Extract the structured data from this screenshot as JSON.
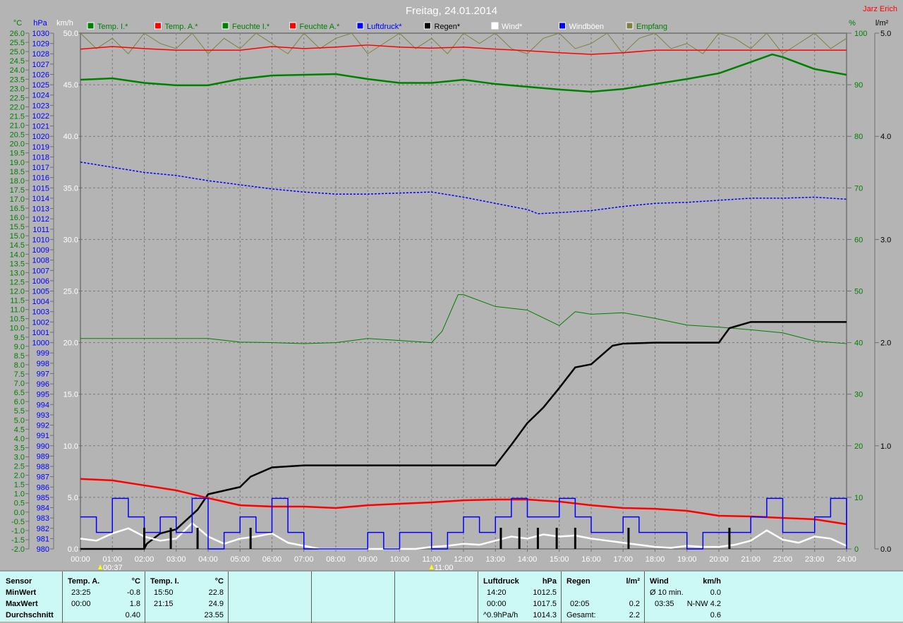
{
  "title": "Freitag, 24.01.2014",
  "author": "Jarz Erich",
  "colors": {
    "background": "#b4b4b4",
    "grid": "#808080",
    "temp_in": "#008000",
    "temp_out": "#ff0000",
    "hum_in": "#008000",
    "hum_out": "#ff0000",
    "pressure": "#0000ff",
    "rain": "#000000",
    "wind": "#ffffff",
    "gust": "#0000ff",
    "reception": "#808040",
    "panel": "#ccf8f6"
  },
  "legend": [
    {
      "label": "Temp. I.*",
      "color": "#008000",
      "text_color": "#008000"
    },
    {
      "label": "Temp. A.*",
      "color": "#ff0000",
      "text_color": "#008000"
    },
    {
      "label": "Feuchte I.*",
      "color": "#008000",
      "text_color": "#008000"
    },
    {
      "label": "Feuchte A.*",
      "color": "#ff0000",
      "text_color": "#008000"
    },
    {
      "label": "Luftdruck*",
      "color": "#0000ff",
      "text_color": "#0000ff"
    },
    {
      "label": "Regen*",
      "color": "#000000",
      "text_color": "#000000"
    },
    {
      "label": "Wind*",
      "color": "#ffffff",
      "text_color": "#ffffff"
    },
    {
      "label": "Windböen",
      "color": "#0000ff",
      "text_color": "#ffffff"
    },
    {
      "label": "Empfang",
      "color": "#808040",
      "text_color": "#008000"
    }
  ],
  "chart_data": {
    "type": "line",
    "title": "Freitag, 24.01.2014",
    "x_unit": "hours",
    "xlim": [
      0,
      24
    ],
    "x_ticks": [
      "00:00",
      "01:00",
      "02:00",
      "03:00",
      "04:00",
      "05:00",
      "06:00",
      "07:00",
      "08:00",
      "09:00",
      "10:00",
      "11:00",
      "12:00",
      "13:00",
      "14:00",
      "15:00",
      "16:00",
      "17:00",
      "18:00",
      "19:00",
      "20:00",
      "21:00",
      "22:00",
      "23:00",
      "24:00"
    ],
    "axes": {
      "temp": {
        "unit": "°C",
        "min": -2.0,
        "max": 26.0,
        "step": 0.5,
        "decimals": 1,
        "color": "#008000"
      },
      "pressure": {
        "unit": "hPa",
        "min": 980,
        "max": 1030,
        "step": 1,
        "decimals": 0,
        "color": "#0000ff"
      },
      "wind": {
        "unit": "km/h",
        "min": 0,
        "max": 50,
        "step": 5,
        "decimals": 1,
        "color": "#ffffff"
      },
      "humidity": {
        "unit": "%",
        "min": 0,
        "max": 100,
        "step": 10,
        "decimals": 0,
        "color": "#008000"
      },
      "rain": {
        "unit": "l/m²",
        "min": 0,
        "max": 5,
        "step": 1,
        "decimals": 1,
        "color": "#000000"
      }
    },
    "grid": true,
    "legend_position": "top",
    "series": [
      {
        "name": "Temp. I.*",
        "axis": "temp",
        "color": "#008000",
        "width": 2.5,
        "x": [
          0,
          1,
          2,
          3,
          4,
          5,
          6,
          7,
          8,
          9,
          10,
          11,
          12,
          13,
          14,
          15,
          16,
          17,
          18,
          19,
          20,
          21,
          21.67,
          22,
          23,
          24
        ],
        "y": [
          23.47,
          23.55,
          23.3,
          23.17,
          23.17,
          23.51,
          23.7,
          23.74,
          23.78,
          23.51,
          23.3,
          23.3,
          23.47,
          23.24,
          23.09,
          22.94,
          22.82,
          22.97,
          23.24,
          23.51,
          23.82,
          24.43,
          24.85,
          24.7,
          24.05,
          23.74
        ]
      },
      {
        "name": "Temp. A.*",
        "axis": "temp",
        "color": "#ff0000",
        "width": 2.5,
        "x": [
          0,
          1,
          2,
          3,
          4,
          5,
          6,
          7,
          8,
          9,
          10,
          11,
          12,
          13,
          14,
          15,
          16,
          17,
          18,
          19,
          20,
          21,
          22,
          23,
          24
        ],
        "y": [
          1.8,
          1.72,
          1.45,
          1.18,
          0.76,
          0.37,
          0.3,
          0.3,
          0.22,
          0.37,
          0.45,
          0.53,
          0.64,
          0.68,
          0.68,
          0.57,
          0.37,
          0.22,
          0.18,
          0.07,
          -0.2,
          -0.24,
          -0.32,
          -0.39,
          -0.66
        ]
      },
      {
        "name": "Feuchte I.*",
        "axis": "humidity",
        "color": "#008000",
        "width": 1,
        "x": [
          0,
          4,
          5,
          6,
          7,
          8,
          9,
          10,
          11,
          11.33,
          11.83,
          12,
          13,
          14,
          15,
          15.5,
          16,
          17,
          18,
          19,
          20,
          21,
          22,
          23,
          24
        ],
        "y": [
          40.8,
          40.8,
          40.1,
          40.0,
          39.8,
          40.0,
          40.8,
          40.4,
          40.0,
          42.2,
          49.3,
          49.3,
          47.0,
          46.3,
          43.3,
          46.0,
          45.5,
          45.8,
          44.7,
          43.4,
          43.0,
          42.5,
          41.9,
          40.3,
          39.8
        ]
      },
      {
        "name": "Feuchte A.*",
        "axis": "humidity",
        "color": "#ff0000",
        "width": 1.5,
        "x": [
          0,
          1,
          2,
          3,
          4,
          5,
          6,
          7,
          8,
          9,
          10,
          11,
          12,
          13,
          14,
          15,
          16,
          17,
          18,
          19,
          20,
          21,
          22,
          23,
          24
        ],
        "y": [
          96.9,
          97.4,
          97.0,
          96.7,
          96.7,
          96.7,
          97.4,
          97.0,
          97.3,
          97.7,
          97.3,
          97.1,
          97.3,
          96.9,
          96.6,
          96.2,
          95.9,
          96.2,
          96.7,
          96.7,
          96.7,
          96.7,
          96.7,
          96.7,
          96.7
        ]
      },
      {
        "name": "Luftdruck*",
        "axis": "pressure",
        "color": "#0000ff",
        "width": 1.5,
        "dashed": true,
        "x": [
          0,
          1,
          2,
          3,
          4,
          5,
          6,
          7,
          8,
          9,
          10,
          11,
          12,
          13,
          14,
          14.33,
          15,
          16,
          17,
          18,
          19,
          20,
          21,
          22,
          23,
          24
        ],
        "y": [
          1017.5,
          1017.0,
          1016.5,
          1016.2,
          1015.7,
          1015.3,
          1014.9,
          1014.6,
          1014.4,
          1014.4,
          1014.5,
          1014.6,
          1014.1,
          1013.5,
          1012.9,
          1012.5,
          1012.6,
          1012.8,
          1013.2,
          1013.5,
          1013.6,
          1013.8,
          1014.0,
          1014.0,
          1014.1,
          1013.9
        ]
      },
      {
        "name": "Regen*",
        "axis": "rain",
        "color": "#000000",
        "width": 2.5,
        "x": [
          0,
          2.0,
          2.08,
          2.5,
          3.0,
          3.67,
          4.0,
          5.0,
          5.33,
          6.0,
          7.0,
          13.0,
          13.5,
          14.0,
          14.5,
          15.0,
          15.5,
          16.0,
          16.67,
          17.0,
          18.0,
          20.0,
          20.33,
          21.0,
          24.0
        ],
        "y": [
          0,
          0,
          0.05,
          0.15,
          0.19,
          0.38,
          0.53,
          0.6,
          0.7,
          0.79,
          0.81,
          0.81,
          1.01,
          1.22,
          1.37,
          1.56,
          1.76,
          1.79,
          1.97,
          1.99,
          2.0,
          2.0,
          2.14,
          2.2,
          2.2
        ]
      },
      {
        "name": "Wind*",
        "axis": "wind",
        "color": "#ffffff",
        "width": 2.5,
        "x": [
          0,
          0.5,
          1,
          1.5,
          2,
          2.5,
          3,
          3.5,
          4,
          4.5,
          5,
          5.5,
          6,
          6.5,
          7,
          7.5,
          8,
          8.5,
          9,
          9.5,
          10,
          10.5,
          11,
          11.5,
          12,
          12.5,
          13,
          13.5,
          14,
          14.5,
          15,
          15.5,
          16,
          16.5,
          17,
          17.5,
          18,
          18.5,
          19,
          19.5,
          20,
          20.5,
          21,
          21.5,
          22,
          22.5,
          23,
          23.5,
          24
        ],
        "y": [
          1.0,
          0.8,
          1.5,
          2.0,
          1.2,
          0.8,
          1.0,
          2.5,
          1.2,
          0.5,
          1.0,
          1.2,
          1.5,
          0.6,
          0.3,
          0,
          0,
          0,
          0,
          0,
          0,
          0,
          0.2,
          0.3,
          0.5,
          0.4,
          0.8,
          1.2,
          1.0,
          1.4,
          1.2,
          1.3,
          1.0,
          0.8,
          0.6,
          0.4,
          0.2,
          0.1,
          0.3,
          0.2,
          0.2,
          0.4,
          0.8,
          1.8,
          0.9,
          0.6,
          1.2,
          1.0,
          0.3
        ]
      },
      {
        "name": "Windböen",
        "axis": "wind",
        "color": "#0000ff",
        "width": 1.5,
        "step": true,
        "x": [
          0,
          0.5,
          1,
          1.5,
          2,
          2.5,
          3,
          3.5,
          4,
          4.5,
          5,
          5.5,
          6,
          6.5,
          7,
          7.5,
          8,
          8.5,
          9,
          9.5,
          10,
          10.5,
          11,
          11.5,
          12,
          12.5,
          13,
          13.5,
          14,
          14.5,
          15,
          15.5,
          16,
          16.5,
          17,
          17.5,
          18,
          18.5,
          19,
          19.5,
          20,
          20.5,
          21,
          21.5,
          22,
          22.5,
          23,
          23.5,
          24
        ],
        "y": [
          3.1,
          1.6,
          4.9,
          3.1,
          1.6,
          3.1,
          1.6,
          4.9,
          0,
          1.6,
          3.1,
          1.6,
          4.9,
          1.6,
          0,
          0,
          0,
          0,
          1.6,
          0,
          1.6,
          1.6,
          0,
          1.6,
          3.1,
          1.6,
          3.1,
          4.9,
          3.1,
          3.1,
          4.9,
          3.1,
          1.6,
          1.6,
          3.1,
          1.6,
          1.6,
          1.6,
          0,
          1.6,
          1.6,
          1.6,
          3.1,
          4.9,
          1.6,
          1.6,
          3.1,
          4.9,
          0
        ]
      },
      {
        "name": "Empfang",
        "axis": "humidity",
        "color": "#808040",
        "width": 1,
        "x": [
          0,
          0.5,
          1,
          1.5,
          2,
          2.5,
          3,
          3.5,
          4,
          4.5,
          5,
          5.5,
          6,
          6.5,
          7,
          7.5,
          8,
          8.5,
          9,
          9.5,
          10,
          10.5,
          11,
          11.5,
          12,
          12.5,
          13,
          13.5,
          14,
          14.5,
          15,
          15.5,
          16,
          16.5,
          17,
          17.5,
          18,
          18.5,
          19,
          19.5,
          20,
          20.5,
          21,
          21.5,
          22,
          22.5,
          23,
          23.5,
          24
        ],
        "y": [
          100,
          97,
          99,
          96,
          100,
          98,
          97,
          100,
          96,
          99,
          97,
          100,
          98,
          96,
          100,
          97,
          99,
          100,
          96,
          98,
          100,
          97,
          99,
          96,
          100,
          98,
          100,
          97,
          96,
          99,
          100,
          97,
          98,
          100,
          96,
          99,
          100,
          97,
          98,
          96,
          100,
          99,
          97,
          100,
          96,
          98,
          100,
          97,
          99
        ]
      }
    ],
    "rain_ticks": [
      2.0,
      2.83,
      3.67,
      5.33,
      13.17,
      13.75,
      14.33,
      14.92,
      15.5,
      17.17,
      20.33
    ],
    "markers": [
      {
        "label": "00:37",
        "time": 0.62,
        "color": "#ffff00"
      },
      {
        "label": "11:00",
        "time": 11.0,
        "color": "#ffff00"
      }
    ]
  },
  "stats": {
    "sensor": {
      "header": "Sensor",
      "rows": [
        "MinWert",
        "MaxWert",
        "Durchschnitt"
      ]
    },
    "temp_out": {
      "header": "Temp. A.",
      "unit": "°C",
      "min_time": "23:25",
      "min": "-0.8",
      "max_time": "00:00",
      "max": "1.8",
      "avg": "0.40"
    },
    "temp_in": {
      "header": "Temp. I.",
      "unit": "°C",
      "min_time": "15:50",
      "min": "22.8",
      "max_time": "21:15",
      "max": "24.9",
      "avg": "23.55"
    },
    "pressure": {
      "header": "Luftdruck",
      "unit": "hPa",
      "min_time": "14:20",
      "min": "1012.5",
      "max_time": "00:00",
      "max": "1017.5",
      "trend": "^0.9hPa/h",
      "avg": "1014.3"
    },
    "rain": {
      "header": "Regen",
      "unit": "l/m²",
      "max_time": "02:05",
      "max": "0.2",
      "total_label": "Gesamt:",
      "total": "2.2"
    },
    "wind": {
      "header": "Wind",
      "unit": "km/h",
      "avg_label": "Ø 10 min.",
      "avg10": "0.0",
      "max_time": "03:35",
      "max": "N-NW 4.2",
      "avg": "0.6"
    }
  }
}
